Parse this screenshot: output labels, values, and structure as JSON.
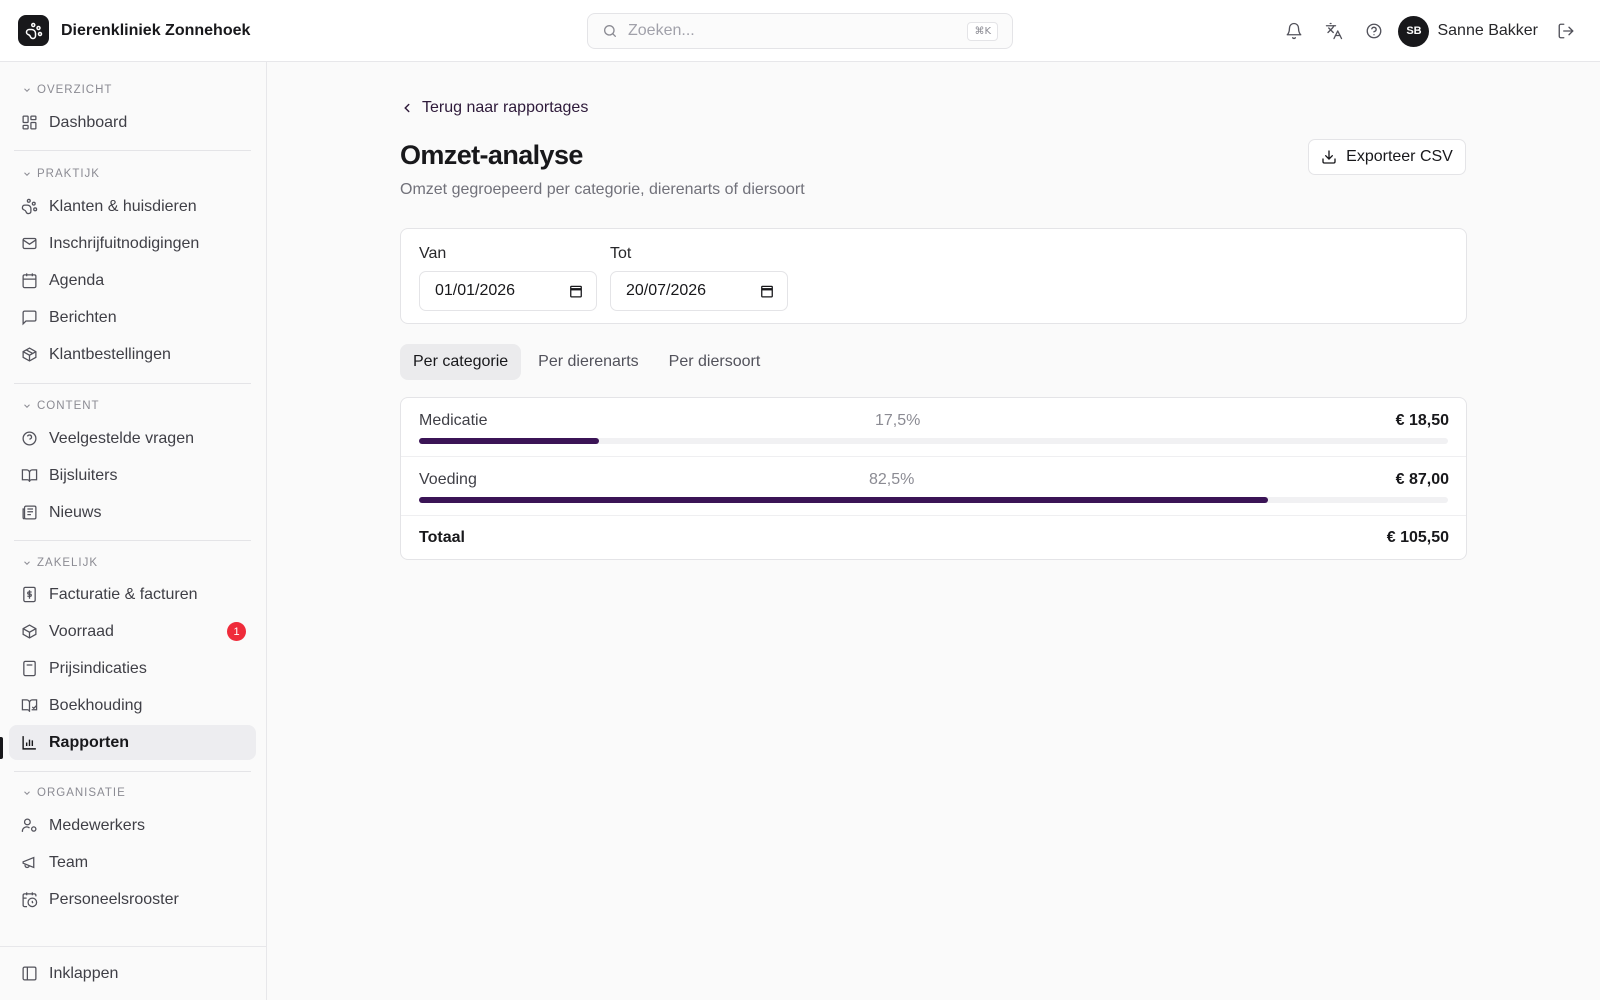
{
  "app": {
    "name": "Dierenkliniek Zonnehoek"
  },
  "search": {
    "placeholder": "Zoeken...",
    "shortcut": "⌘K"
  },
  "header": {
    "icons": [
      "bell-icon",
      "translate-icon",
      "help-icon"
    ],
    "user_initials": "SB",
    "user_name": "Sanne Bakker"
  },
  "sidebar": {
    "groups": [
      {
        "label": "OVERZICHT",
        "items": [
          {
            "label": "Dashboard",
            "icon": "dashboard-icon"
          }
        ]
      },
      {
        "label": "PRAKTIJK",
        "items": [
          {
            "label": "Klanten & huisdieren",
            "icon": "paw-icon"
          },
          {
            "label": "Inschrijfuitnodigingen",
            "icon": "mail-icon"
          },
          {
            "label": "Agenda",
            "icon": "calendar-icon"
          },
          {
            "label": "Berichten",
            "icon": "message-icon"
          },
          {
            "label": "Klantbestellingen",
            "icon": "package-icon"
          }
        ]
      },
      {
        "label": "CONTENT",
        "items": [
          {
            "label": "Veelgestelde vragen",
            "icon": "help-icon"
          },
          {
            "label": "Bijsluiters",
            "icon": "book-icon"
          },
          {
            "label": "Nieuws",
            "icon": "newspaper-icon"
          }
        ]
      },
      {
        "label": "ZAKELIJK",
        "items": [
          {
            "label": "Facturatie & facturen",
            "icon": "invoice-icon"
          },
          {
            "label": "Voorraad",
            "icon": "box-icon",
            "badge": "1"
          },
          {
            "label": "Prijsindicaties",
            "icon": "calculator-icon"
          },
          {
            "label": "Boekhouding",
            "icon": "ledger-icon"
          },
          {
            "label": "Rapporten",
            "icon": "bar-chart-icon",
            "active": true
          }
        ]
      },
      {
        "label": "ORGANISATIE",
        "items": [
          {
            "label": "Medewerkers",
            "icon": "user-cog-icon"
          },
          {
            "label": "Team",
            "icon": "megaphone-icon"
          },
          {
            "label": "Personeelsrooster",
            "icon": "calendar-clock-icon"
          }
        ]
      }
    ],
    "collapse_label": "Inklappen"
  },
  "page": {
    "back_label": "Terug naar rapportages",
    "title": "Omzet-analyse",
    "subtitle": "Omzet gegroepeerd per categorie, dierenarts of diersoort",
    "export_label": "Exporteer CSV"
  },
  "filters": {
    "from_label": "Van",
    "from_value": "01/01/2026",
    "to_label": "Tot",
    "to_value": "20/07/2026"
  },
  "tabs": [
    {
      "label": "Per categorie",
      "active": true
    },
    {
      "label": "Per dierenarts",
      "active": false
    },
    {
      "label": "Per diersoort",
      "active": false
    }
  ],
  "results": {
    "rows": [
      {
        "label": "Medicatie",
        "percent": "17,5%",
        "amount": "€ 18,50",
        "share": 0.175
      },
      {
        "label": "Voeding",
        "percent": "82,5%",
        "amount": "€ 87,00",
        "share": 0.825
      }
    ],
    "total_label": "Totaal",
    "total_amount": "€ 105,50"
  },
  "colors": {
    "accent": "#3b1456",
    "badge": "#ef2b3a"
  }
}
